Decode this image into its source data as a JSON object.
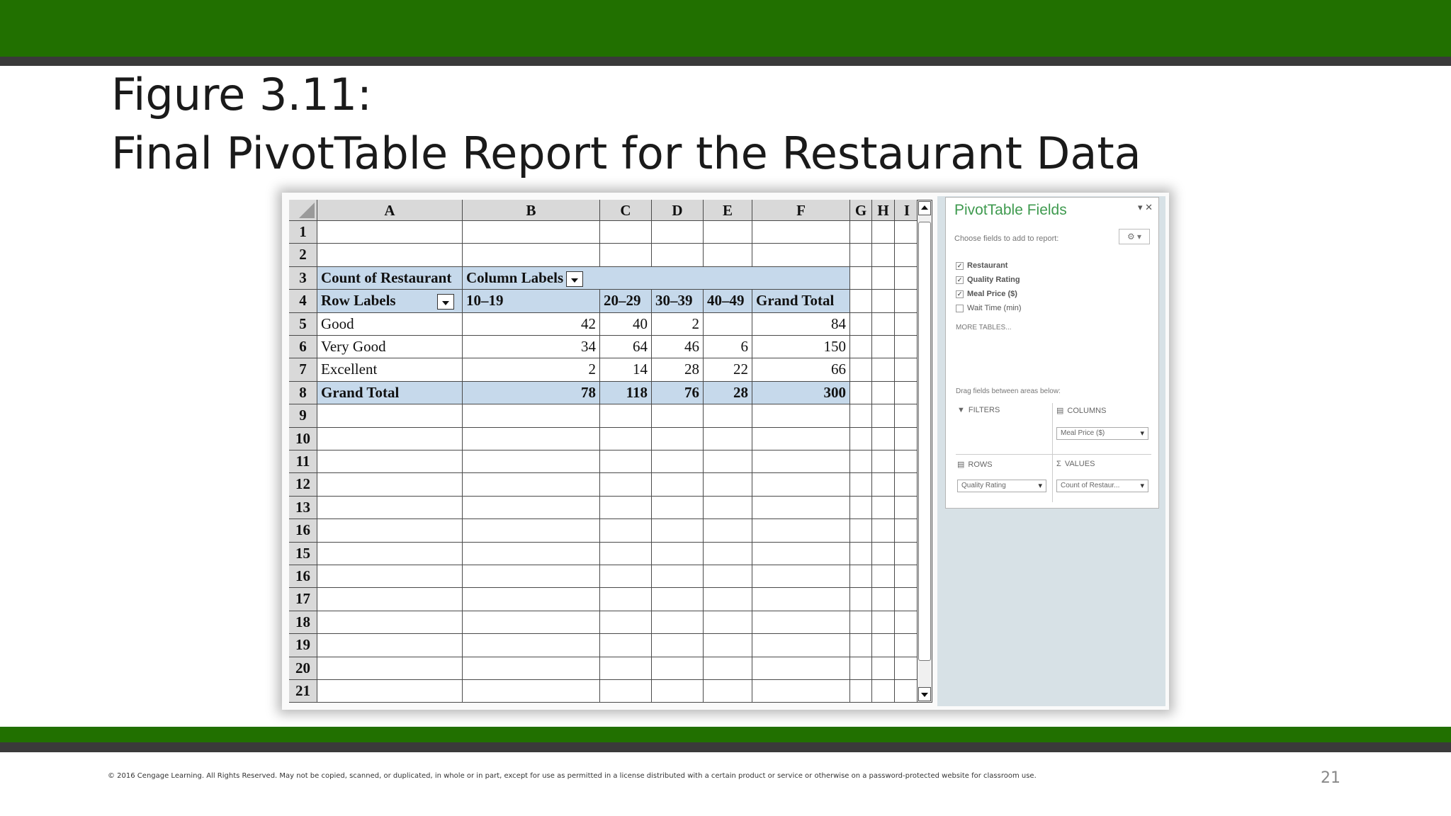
{
  "slide": {
    "title_line1": "Figure 3.11:",
    "title_line2": "Final PivotTable Report for the Restaurant Data",
    "footer": "© 2016 Cengage Learning.  All Rights Reserved.  May not be copied, scanned, or duplicated, in whole or in part, except for use as permitted in a license distributed with a certain product or service or otherwise on a password-protected website for classroom use.",
    "page_number": "21",
    "colors": {
      "bar": "#217000",
      "stripe": "#3a3a3a",
      "pivot_fill": "#c6d9eb"
    }
  },
  "spreadsheet": {
    "columns": [
      "A",
      "B",
      "C",
      "D",
      "E",
      "F",
      "G",
      "H",
      "I"
    ],
    "row_numbers": [
      "1",
      "2",
      "3",
      "4",
      "5",
      "6",
      "7",
      "8",
      "9",
      "10",
      "11",
      "12",
      "13",
      "16",
      "15",
      "16",
      "17",
      "18",
      "19",
      "20",
      "21"
    ],
    "pivot": {
      "corner_label": "Count of Restaurant",
      "column_labels": "Column Labels",
      "row_labels": "Row Labels",
      "column_headers": [
        "10–19",
        "20–29",
        "30–39",
        "40–49",
        "Grand Total"
      ],
      "rows": [
        {
          "label": "Good",
          "values": [
            "42",
            "40",
            "2",
            "",
            "84"
          ]
        },
        {
          "label": "Very Good",
          "values": [
            "34",
            "64",
            "46",
            "6",
            "150"
          ]
        },
        {
          "label": "Excellent",
          "values": [
            "2",
            "14",
            "28",
            "22",
            "66"
          ]
        },
        {
          "label": "Grand Total",
          "values": [
            "78",
            "118",
            "76",
            "28",
            "300"
          ]
        }
      ]
    }
  },
  "pivot_fields_pane": {
    "title": "PivotTable Fields",
    "controls": "▾ ✕",
    "instruction": "Choose fields to add to report:",
    "tool_icon": "⚙ ▾",
    "fields": [
      {
        "label": "Restaurant",
        "checked": true
      },
      {
        "label": "Quality Rating",
        "checked": true
      },
      {
        "label": "Meal Price ($)",
        "checked": true
      },
      {
        "label": "Wait Time (min)",
        "checked": false
      }
    ],
    "more_tables": "MORE TABLES...",
    "drag_hint": "Drag fields between areas below:",
    "areas": {
      "filters": "FILTERS",
      "columns": "COLUMNS",
      "rows": "ROWS",
      "values": "VALUES",
      "columns_value": "Meal Price ($)",
      "rows_value": "Quality Rating",
      "values_value": "Count of Restaur..."
    }
  }
}
